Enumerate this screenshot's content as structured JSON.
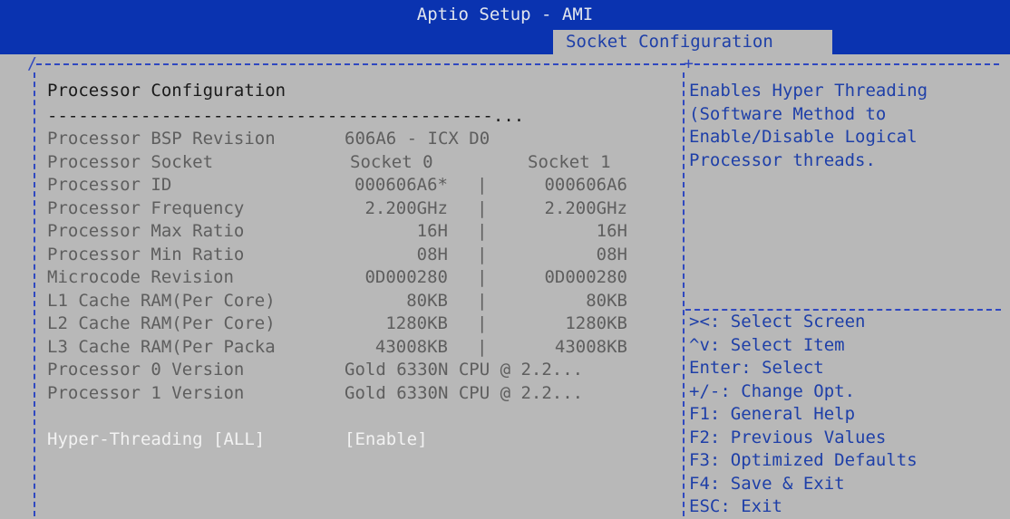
{
  "header": {
    "app_title": "Aptio Setup - AMI",
    "active_tab": "Socket Configuration"
  },
  "colors": {
    "header_bg": "#0a33b0",
    "screen_bg": "#b8b8b8",
    "help_text": "#1e3fa8",
    "item_grey": "#5e5e5e",
    "selected_white": "#f2f2f2"
  },
  "left": {
    "title": "Processor Configuration",
    "separator": "-------------------------------------------...",
    "rows": [
      {
        "label": "Processor BSP Revision",
        "v0": "606A6 - ICX D0",
        "sep": "",
        "v1": ""
      },
      {
        "label": "Processor Socket",
        "v0": "Socket 0",
        "sep": "",
        "v1": "Socket 1"
      },
      {
        "label": "Processor ID",
        "v0": "000606A6*",
        "sep": "|",
        "v1": "000606A6"
      },
      {
        "label": "Processor Frequency",
        "v0": "2.200GHz",
        "sep": "|",
        "v1": "2.200GHz"
      },
      {
        "label": "Processor Max Ratio",
        "v0": "16H",
        "sep": "|",
        "v1": "16H"
      },
      {
        "label": "Processor Min Ratio",
        "v0": "08H",
        "sep": "|",
        "v1": "08H"
      },
      {
        "label": "Microcode Revision",
        "v0": "0D000280",
        "sep": "|",
        "v1": "0D000280"
      },
      {
        "label": "L1 Cache RAM(Per Core)",
        "v0": "80KB",
        "sep": "|",
        "v1": "80KB"
      },
      {
        "label": "L2 Cache RAM(Per Core)",
        "v0": "1280KB",
        "sep": "|",
        "v1": "1280KB"
      },
      {
        "label": "L3 Cache RAM(Per Packa",
        "v0": "43008KB",
        "sep": "|",
        "v1": "43008KB"
      },
      {
        "label": "Processor 0 Version",
        "v0": "Gold 6330N CPU @ 2.2...",
        "sep": "",
        "v1": ""
      },
      {
        "label": "Processor 1 Version",
        "v0": "Gold 6330N CPU @ 2.2...",
        "sep": "",
        "v1": ""
      }
    ],
    "setting": {
      "label": "Hyper-Threading [ALL]",
      "value": "[Enable]"
    }
  },
  "right": {
    "help_lines": [
      "Enables Hyper Threading",
      "(Software Method to",
      "Enable/Disable Logical",
      "Processor threads."
    ],
    "keys": [
      "><: Select Screen",
      "^v: Select Item",
      "Enter: Select",
      "+/-: Change Opt.",
      "F1: General Help",
      "F2: Previous Values",
      "F3: Optimized Defaults",
      "F4: Save & Exit",
      "ESC: Exit"
    ]
  }
}
